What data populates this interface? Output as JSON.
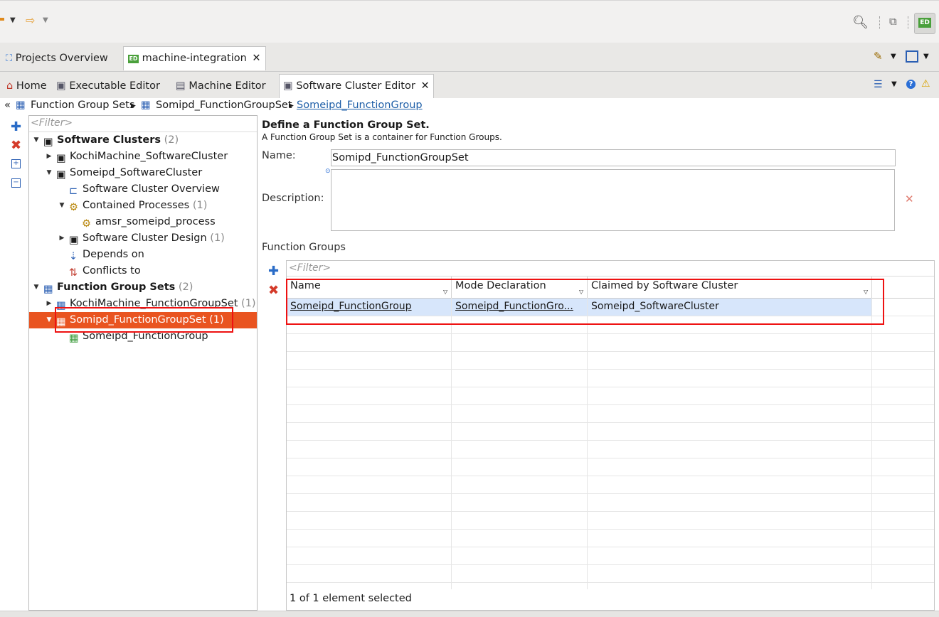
{
  "view_tabs": [
    {
      "label": "Projects Overview",
      "icon": "projects-icon"
    },
    {
      "label": "machine-integration",
      "icon": "ed-icon"
    }
  ],
  "editor_tabs": [
    {
      "label": "Home",
      "icon": "home-icon"
    },
    {
      "label": "Executable Editor",
      "icon": "executable-icon"
    },
    {
      "label": "Machine Editor",
      "icon": "machine-icon"
    },
    {
      "label": "Software Cluster Editor",
      "icon": "software-cluster-icon"
    }
  ],
  "breadcrumb": [
    "Function Group Sets",
    "Somipd_FunctionGroupSet",
    "Someipd_FunctionGroup"
  ],
  "tree": {
    "filter_placeholder": "<Filter>",
    "software_clusters_label": "Software Clusters",
    "software_clusters_count": "(2)",
    "kochi_cluster": "KochiMachine_SoftwareCluster",
    "someipd_cluster": "Someipd_SoftwareCluster",
    "overview": "Software Cluster Overview",
    "contained_processes": "Contained Processes",
    "contained_processes_count": "(1)",
    "process": "amsr_someipd_process",
    "design": "Software Cluster Design",
    "design_count": "(1)",
    "depends_on": "Depends on",
    "conflicts_to": "Conflicts to",
    "function_group_sets_label": "Function Group Sets",
    "function_group_sets_count": "(2)",
    "kochi_fgs": "KochiMachine_FunctionGroupSet",
    "kochi_fgs_count": "(1)",
    "somipd_fgs": "Somipd_FunctionGroupSet",
    "somipd_fgs_count": "(1)",
    "someipd_fg": "Someipd_FunctionGroup"
  },
  "editor": {
    "heading": "Define a Function Group Set.",
    "subheading": "A Function Group Set is a container for Function Groups.",
    "name_label": "Name:",
    "name_value": "Somipd_FunctionGroupSet",
    "description_label": "Description:",
    "description_value": "",
    "function_groups_label": "Function Groups",
    "table_filter_placeholder": "<Filter>",
    "columns": [
      "Name",
      "Mode Declaration",
      "Claimed by Software Cluster"
    ],
    "rows": [
      {
        "name": "Someipd_FunctionGroup",
        "mode": "Someipd_FunctionGro...",
        "claimed": "Someipd_SoftwareCluster"
      }
    ],
    "status": "1 of 1 element selected"
  },
  "colors": {
    "selection": "#e95420",
    "row_highlight": "#d7e6fb",
    "link": "#1f5fa8",
    "annotation": "#e11111"
  }
}
